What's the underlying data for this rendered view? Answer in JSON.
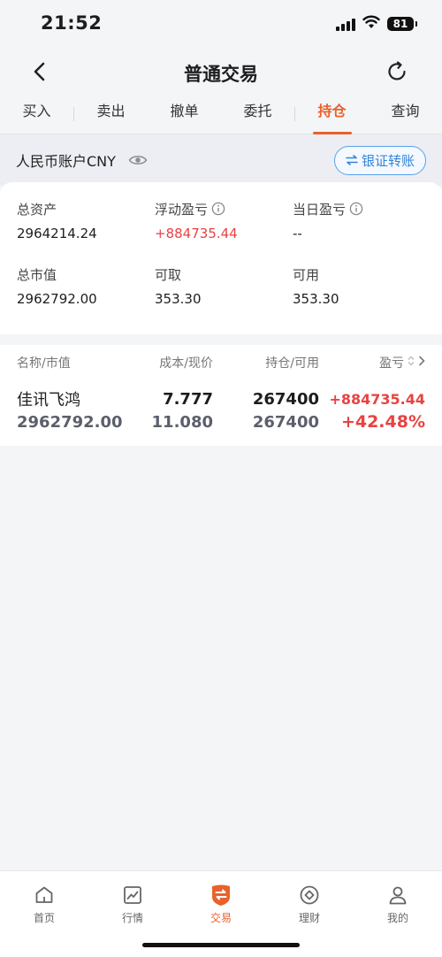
{
  "status": {
    "time": "21:52",
    "battery": "81"
  },
  "nav": {
    "title": "普通交易"
  },
  "tabs": [
    {
      "label": "买入"
    },
    {
      "label": "卖出"
    },
    {
      "label": "撤单"
    },
    {
      "label": "委托"
    },
    {
      "label": "持仓"
    },
    {
      "label": "查询"
    }
  ],
  "active_tab": "持仓",
  "account": {
    "label": "人民币账户CNY",
    "transfer_button": "银证转账"
  },
  "summary": {
    "total_assets": {
      "label": "总资产",
      "value": "2964214.24"
    },
    "floating_pl": {
      "label": "浮动盈亏",
      "value": "+884735.44"
    },
    "daily_pl": {
      "label": "当日盈亏",
      "value": "--"
    },
    "market_value": {
      "label": "总市值",
      "value": "2962792.00"
    },
    "withdrawable": {
      "label": "可取",
      "value": "353.30"
    },
    "available": {
      "label": "可用",
      "value": "353.30"
    }
  },
  "holdings": {
    "headers": {
      "name": "名称/市值",
      "cost": "成本/现价",
      "position": "持仓/可用",
      "pl": "盈亏"
    },
    "rows": [
      {
        "name": "佳讯飞鸿",
        "market_value": "2962792.00",
        "cost": "7.777",
        "price": "11.080",
        "position": "267400",
        "available": "267400",
        "pl": "+884735.44",
        "pl_pct": "+42.48%"
      }
    ]
  },
  "bottom_nav": [
    {
      "label": "首页",
      "icon": "home-icon"
    },
    {
      "label": "行情",
      "icon": "chart-icon"
    },
    {
      "label": "交易",
      "icon": "trade-icon"
    },
    {
      "label": "理财",
      "icon": "coin-icon"
    },
    {
      "label": "我的",
      "icon": "user-icon"
    }
  ],
  "colors": {
    "accent": "#e8622c",
    "up": "#e94242",
    "link": "#3485d8"
  }
}
